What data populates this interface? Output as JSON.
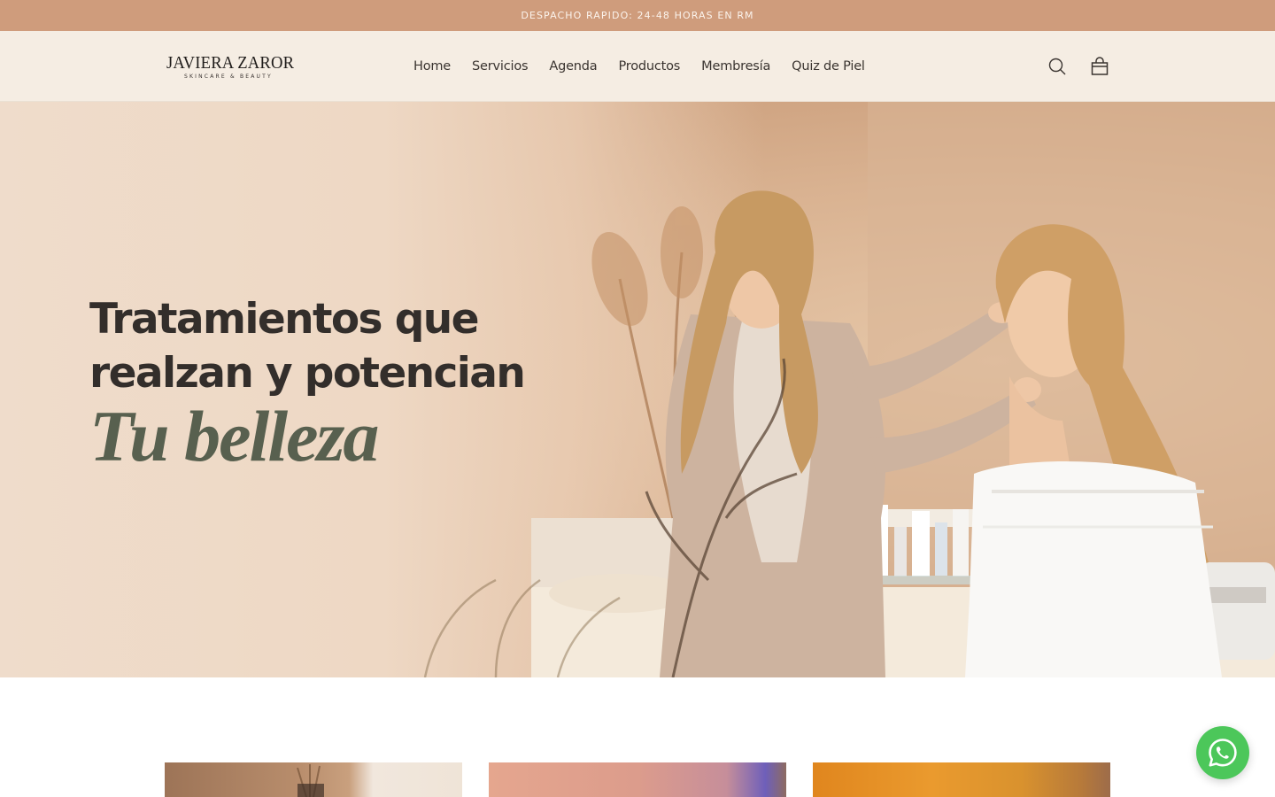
{
  "announcement": {
    "text": "DESPACHO RAPIDO: 24-48 HORAS EN RM"
  },
  "header": {
    "logo": {
      "name": "JAVIERA ZAROR",
      "tagline": "SKINCARE & BEAUTY"
    },
    "nav": [
      "Home",
      "Servicios",
      "Agenda",
      "Productos",
      "Membresía",
      "Quiz de Piel"
    ],
    "icons": {
      "search": "search-icon",
      "cart": "shopping-bag-icon"
    }
  },
  "hero": {
    "line1": "Tratamientos que",
    "line2": "realzan y potencian",
    "script": "Tu belleza",
    "image": "esthetician-touching-client-face-photo"
  },
  "cards": [
    {
      "image": "spa-room-with-dried-pampas-photo"
    },
    {
      "image": "skin-treatment-closeup-photo"
    },
    {
      "image": "orange-skincare-product-photo"
    }
  ],
  "floating": {
    "whatsapp": "whatsapp-icon"
  },
  "colors": {
    "announcement_bg": "#cf9c7c",
    "header_bg": "#f5ede3",
    "headline": "#332e2b",
    "script_accent": "#58604f",
    "whatsapp": "#4cc75a"
  }
}
